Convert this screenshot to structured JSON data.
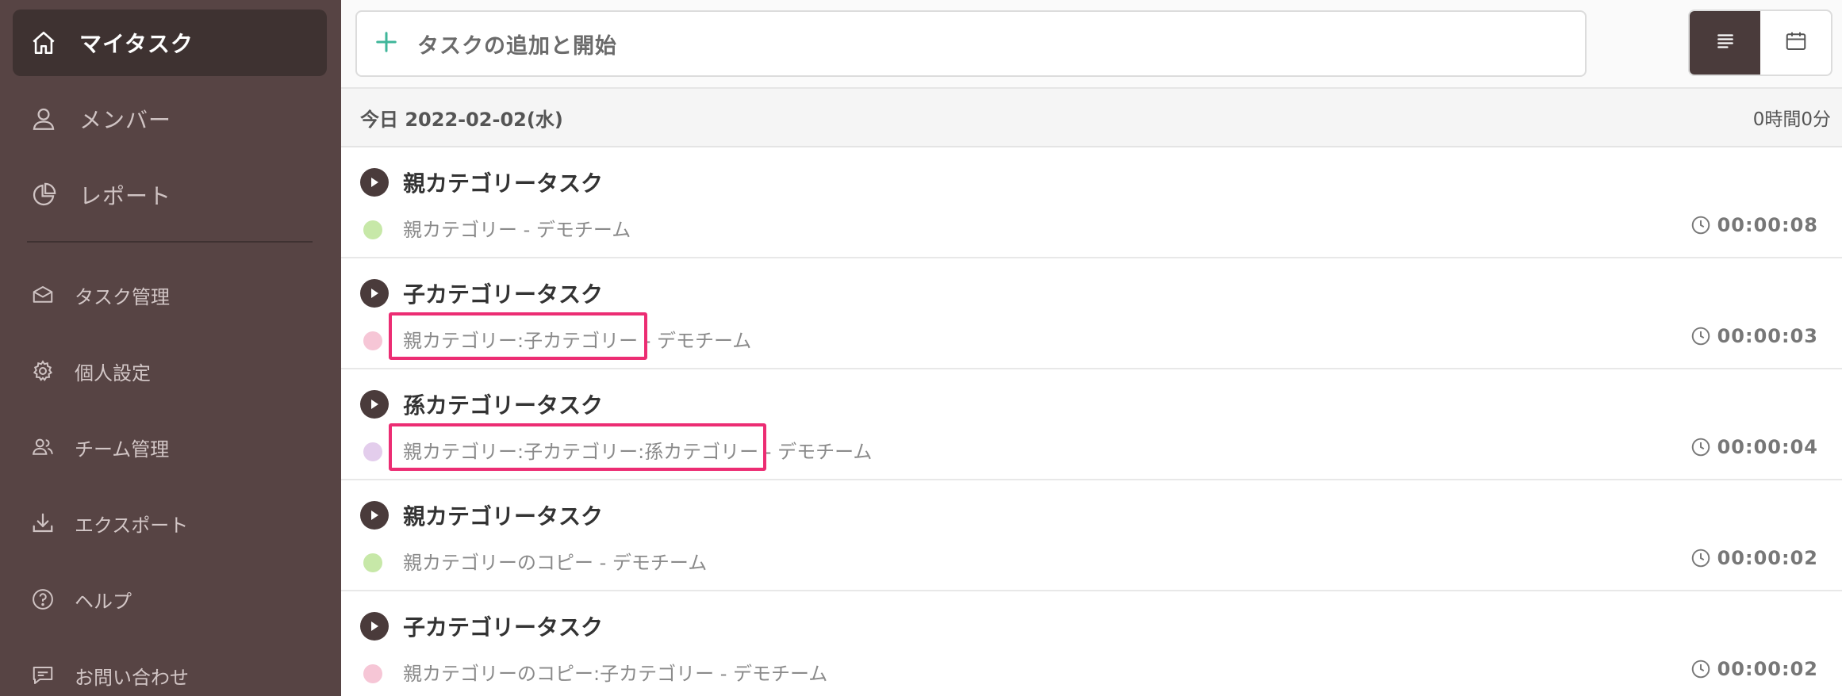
{
  "sidebar": {
    "main_items": [
      {
        "label": "マイタスク",
        "icon": "home-icon",
        "active": true
      },
      {
        "label": "メンバー",
        "icon": "user-icon",
        "active": false
      },
      {
        "label": "レポート",
        "icon": "pie-chart-icon",
        "active": false
      }
    ],
    "sub_items": [
      {
        "label": "タスク管理",
        "icon": "inbox-icon"
      },
      {
        "label": "個人設定",
        "icon": "gear-icon"
      },
      {
        "label": "チーム管理",
        "icon": "team-icon"
      },
      {
        "label": "エクスポート",
        "icon": "download-icon"
      },
      {
        "label": "ヘルプ",
        "icon": "help-icon"
      },
      {
        "label": "お問い合わせ",
        "icon": "message-icon"
      }
    ]
  },
  "topbar": {
    "add_task_placeholder": "タスクの追加と開始",
    "view_modes": [
      {
        "name": "list-view",
        "icon": "list-icon",
        "active": true
      },
      {
        "name": "calendar-view",
        "icon": "calendar-icon",
        "active": false
      }
    ]
  },
  "day": {
    "date_label": "今日 2022-02-02(水)",
    "total_time": "0時間0分"
  },
  "tasks": [
    {
      "title": "親カテゴリータスク",
      "category": "親カテゴリー - デモチーム",
      "color": "#c7e8a8",
      "duration": "00:00:08"
    },
    {
      "title": "子カテゴリータスク",
      "category": "親カテゴリー:子カテゴリー - デモチーム",
      "color": "#f6c6d6",
      "duration": "00:00:03"
    },
    {
      "title": "孫カテゴリータスク",
      "category": "親カテゴリー:子カテゴリー:孫カテゴリー - デモチーム",
      "color": "#e3cdec",
      "duration": "00:00:04"
    },
    {
      "title": "親カテゴリータスク",
      "category": "親カテゴリーのコピー - デモチーム",
      "color": "#c7e8a8",
      "duration": "00:00:02"
    },
    {
      "title": "子カテゴリータスク",
      "category": "親カテゴリーのコピー:子カテゴリー - デモチーム",
      "color": "#f6c6d6",
      "duration": "00:00:02"
    }
  ],
  "colors": {
    "sidebar_bg": "#574444",
    "sidebar_active": "#3e3231",
    "accent_plus": "#3fb69a",
    "highlight_box": "#ec2d73",
    "play_button": "#4a3b3b"
  }
}
